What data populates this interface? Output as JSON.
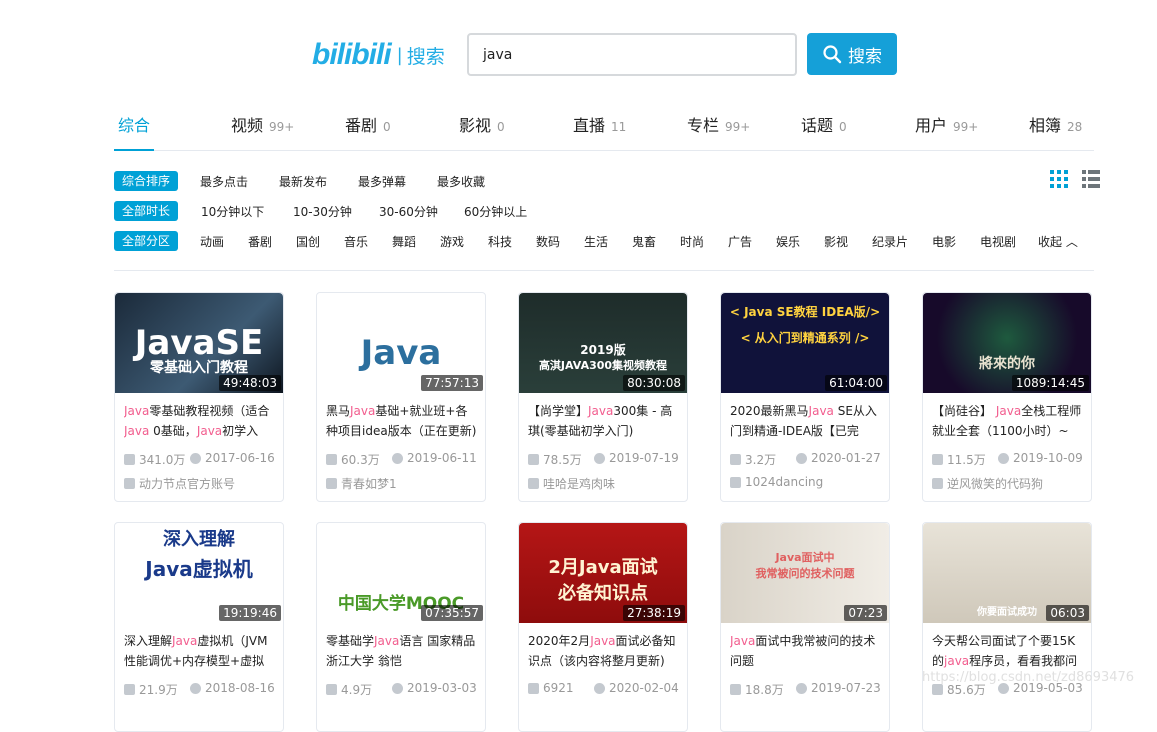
{
  "logo": {
    "mark": "bilibili",
    "sep": "|",
    "text": "搜索"
  },
  "search": {
    "value": "java",
    "button": "搜索"
  },
  "tabs": [
    {
      "label": "综合",
      "count": ""
    },
    {
      "label": "视频",
      "count": "99+"
    },
    {
      "label": "番剧",
      "count": "0"
    },
    {
      "label": "影视",
      "count": "0"
    },
    {
      "label": "直播",
      "count": "11"
    },
    {
      "label": "专栏",
      "count": "99+"
    },
    {
      "label": "话题",
      "count": "0"
    },
    {
      "label": "用户",
      "count": "99+"
    },
    {
      "label": "相簿",
      "count": "28"
    }
  ],
  "filters": {
    "order": {
      "active": "综合排序",
      "options": [
        "最多点击",
        "最新发布",
        "最多弹幕",
        "最多收藏"
      ]
    },
    "duration": {
      "active": "全部时长",
      "options": [
        "10分钟以下",
        "10-30分钟",
        "30-60分钟",
        "60分钟以上"
      ]
    },
    "zone": {
      "active": "全部分区",
      "options": [
        "动画",
        "番剧",
        "国创",
        "音乐",
        "舞蹈",
        "游戏",
        "科技",
        "数码",
        "生活",
        "鬼畜",
        "时尚",
        "广告",
        "娱乐",
        "影视",
        "纪录片",
        "电影",
        "电视剧"
      ],
      "collapse": "收起"
    }
  },
  "accent": "#00a1d6",
  "keyword_color": "#f25d8e",
  "videos": [
    {
      "title_parts": [
        "",
        "Java",
        "零基础教程视频（适合",
        "Java",
        " 0基础，",
        "Java",
        "初学入"
      ],
      "duration": "49:48:03",
      "plays": "341.0万",
      "date": "2017-06-16",
      "author": "动力节点官方账号",
      "thumb_text": "JavaSE",
      "thumb_sub": "零基础入门教程"
    },
    {
      "title_parts": [
        "黑马",
        "Java",
        "基础+就业班+各种项目idea版本（正在更新)"
      ],
      "duration": "77:57:13",
      "plays": "60.3万",
      "date": "2019-06-11",
      "author": "青春如梦1",
      "thumb_text": "Java",
      "thumb_sub": ""
    },
    {
      "title_parts": [
        "【尚学堂】",
        "Java",
        "300集 - 高琪(零基础初学入门)"
      ],
      "duration": "80:30:08",
      "plays": "78.5万",
      "date": "2019-07-19",
      "author": "哇哈是鸡肉味",
      "thumb_text": "2019版",
      "thumb_sub": "高淇JAVA300集视频教程"
    },
    {
      "title_parts": [
        "2020最新黑马",
        "Java",
        " SE从入门到精通-IDEA版【已完"
      ],
      "duration": "61:04:00",
      "plays": "3.2万",
      "date": "2020-01-27",
      "author": "1024dancing",
      "thumb_text": "< Java SE教程 IDEA版/>",
      "thumb_sub": "< 从入门到精通系列 />"
    },
    {
      "title_parts": [
        "【尚硅谷】 ",
        "Java",
        "全栈工程师 就业全套（1100小时）~"
      ],
      "duration": "1089:14:45",
      "plays": "11.5万",
      "date": "2019-10-09",
      "author": "逆风微笑的代码狗",
      "thumb_text": "將來的你",
      "thumb_sub": ""
    },
    {
      "title_parts": [
        "深入理解",
        "Java",
        "虚拟机（JVM性能调优+内存模型+虚拟机"
      ],
      "duration": "19:19:46",
      "plays": "21.9万",
      "date": "2018-08-16",
      "author": "",
      "thumb_text": "深入理解",
      "thumb_sub": "Java虚拟机"
    },
    {
      "title_parts": [
        "零基础学",
        "Java",
        "语言 国家精品 浙江大学 翁恺"
      ],
      "duration": "07:35:57",
      "plays": "4.9万",
      "date": "2019-03-03",
      "author": "",
      "thumb_text": "中国大学MOOC",
      "thumb_sub": ""
    },
    {
      "title_parts": [
        "2020年2月",
        "Java",
        "面试必备知识点（该内容将整月更新)"
      ],
      "duration": "27:38:19",
      "plays": "6921",
      "date": "2020-02-04",
      "author": "",
      "thumb_text": "2月Java面试",
      "thumb_sub": "必备知识点"
    },
    {
      "title_parts": [
        "",
        "Java",
        "面试中我常被问的技术问题"
      ],
      "duration": "07:23",
      "plays": "18.8万",
      "date": "2019-07-23",
      "author": "",
      "thumb_text": "Java面试中",
      "thumb_sub": "我常被问的技术问题"
    },
    {
      "title_parts": [
        "今天帮公司面试了个要15K的",
        "java",
        "程序员，看看我都问"
      ],
      "duration": "06:03",
      "plays": "85.6万",
      "date": "2019-05-03",
      "author": "",
      "thumb_text": "你要面试成功",
      "thumb_sub": ""
    }
  ],
  "watermark": "https://blog.csdn.net/zd8693476"
}
